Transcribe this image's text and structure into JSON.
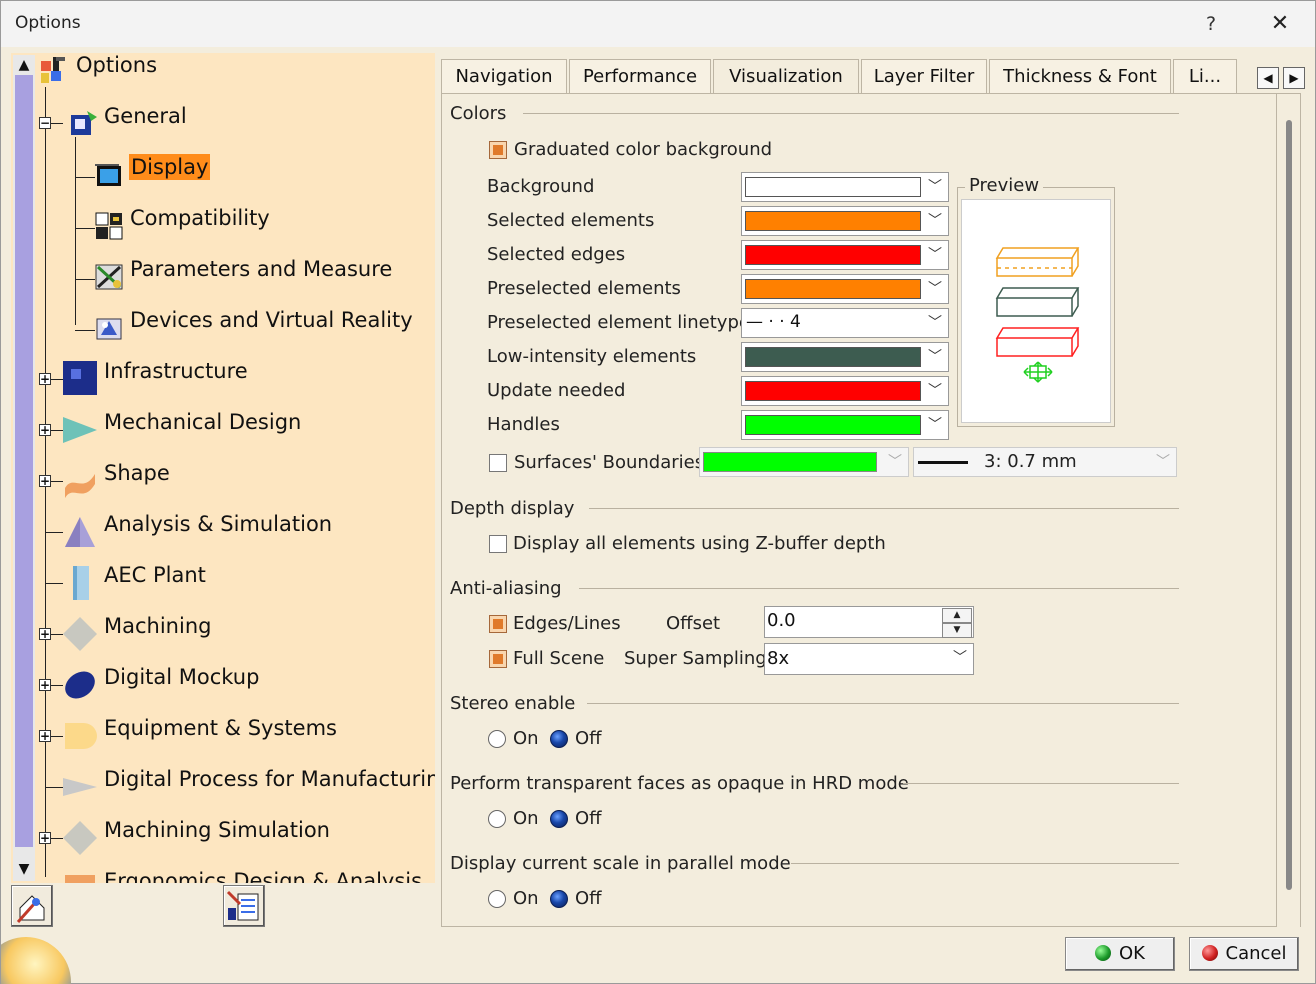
{
  "window": {
    "title": "Options",
    "help_glyph": "?",
    "close_glyph": "✕"
  },
  "tree": {
    "root": "Options",
    "general": "General",
    "general_children": [
      "Display",
      "Compatibility",
      "Parameters and Measure",
      "Devices and Virtual Reality"
    ],
    "top_items": [
      "Infrastructure",
      "Mechanical Design",
      "Shape",
      "Analysis & Simulation",
      "AEC Plant",
      "Machining",
      "Digital Mockup",
      "Equipment & Systems",
      "Digital Process for Manufacturing",
      "Machining Simulation",
      "Ergonomics Design & Analysis"
    ],
    "scroll_up": "▲",
    "scroll_down": "▼"
  },
  "tabs": [
    "Navigation",
    "Performance",
    "Visualization",
    "Layer Filter",
    "Thickness & Font",
    "Li..."
  ],
  "tab_nav": [
    "◀",
    "▶"
  ],
  "colors": {
    "section": "Colors",
    "graduated_label": "Graduated color background",
    "rows": [
      {
        "label": "Background",
        "color": "#ffffff"
      },
      {
        "label": "Selected elements",
        "color": "#ff8000"
      },
      {
        "label": "Selected edges",
        "color": "#ff0000"
      },
      {
        "label": "Preselected elements",
        "color": "#ff8000"
      },
      {
        "label": "Preselected element linetype",
        "value": "— · · 4"
      },
      {
        "label": "Low-intensity elements",
        "color": "#3d5c50"
      },
      {
        "label": "Update needed",
        "color": "#ff0000"
      },
      {
        "label": "Handles",
        "color": "#00ff00"
      }
    ],
    "preview_label": "Preview",
    "surfaces_label": "Surfaces' Boundaries",
    "surfaces_color": "#00ff00",
    "surfaces_thickness": "3: 0.7 mm"
  },
  "depth": {
    "section": "Depth display",
    "zbuffer_label": "Display all elements using Z-buffer depth"
  },
  "aa": {
    "section": "Anti-aliasing",
    "edges_label": "Edges/Lines",
    "offset_label": "Offset",
    "offset_value": "0.0",
    "full_label": "Full Scene",
    "ss_label": "Super Sampling",
    "ss_value": "8x"
  },
  "stereo": {
    "section": "Stereo enable",
    "on": "On",
    "off": "Off"
  },
  "hrd": {
    "section": "Perform transparent faces as opaque in HRD mode",
    "on": "On",
    "off": "Off"
  },
  "scale": {
    "section": "Display current scale in parallel mode",
    "on": "On",
    "off": "Off"
  },
  "buttons": {
    "ok": "OK",
    "cancel": "Cancel"
  },
  "chevron": "﹀"
}
